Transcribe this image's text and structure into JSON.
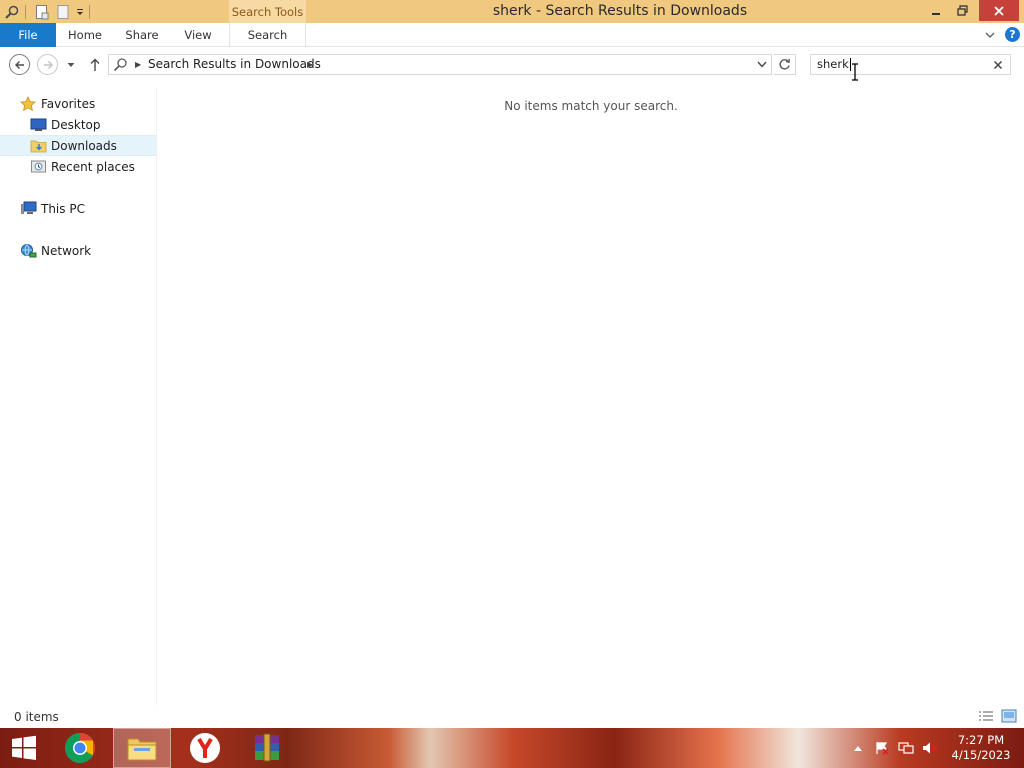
{
  "window": {
    "title": "sherk - Search Results in Downloads",
    "contextual_tab_header": "Search Tools"
  },
  "ribbon": {
    "tabs": [
      {
        "label": "File"
      },
      {
        "label": "Home"
      },
      {
        "label": "Share"
      },
      {
        "label": "View"
      },
      {
        "label": "Search"
      }
    ],
    "help_glyph": "?"
  },
  "address_bar": {
    "path": "Search Results in Downloads"
  },
  "search": {
    "value": "sherk"
  },
  "nav_pane": {
    "items": [
      {
        "label": "Favorites",
        "icon": "star-icon"
      },
      {
        "label": "Desktop",
        "icon": "desktop-icon"
      },
      {
        "label": "Downloads",
        "icon": "downloads-folder-icon",
        "selected": true
      },
      {
        "label": "Recent places",
        "icon": "recent-places-icon"
      },
      {
        "label": "This PC",
        "icon": "computer-icon"
      },
      {
        "label": "Network",
        "icon": "network-icon"
      }
    ]
  },
  "content": {
    "empty_message": "No items match your search."
  },
  "status_bar": {
    "item_count": "0 items"
  },
  "taskbar": {
    "apps": [
      "chrome-icon",
      "file-explorer-icon",
      "yandex-browser-icon",
      "winrar-icon"
    ],
    "clock_time": "7:27 PM",
    "clock_date": "4/15/2023"
  },
  "colors": {
    "title_bar": "#f1c880",
    "file_tab": "#1979ca",
    "close_button": "#c7413b",
    "selection": "#e5f3fb"
  }
}
